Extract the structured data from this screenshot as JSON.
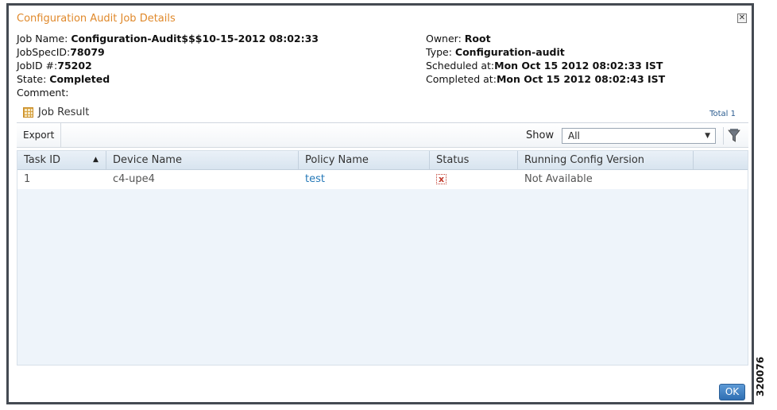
{
  "dialog": {
    "title": "Configuration Audit Job Details",
    "close_icon": "close-icon"
  },
  "details_left": [
    {
      "label": "Job Name: ",
      "value": "Configuration-Audit$$$10-15-2012 08:02:33"
    },
    {
      "label": "JobSpecID:",
      "value": "78079"
    },
    {
      "label": "JobID #:",
      "value": "75202"
    },
    {
      "label": "State: ",
      "value": "Completed"
    },
    {
      "label": "Comment:",
      "value": ""
    }
  ],
  "details_right": [
    {
      "label": "Owner: ",
      "value": "Root"
    },
    {
      "label": "Type: ",
      "value": "Configuration-audit"
    },
    {
      "label": "Scheduled at:",
      "value": "Mon Oct 15 2012 08:02:33 IST"
    },
    {
      "label": "Completed at:",
      "value": "Mon Oct 15 2012 08:02:43 IST"
    }
  ],
  "job_result": {
    "label": "Job Result",
    "icon": "table-grid-icon",
    "total": "Total 1"
  },
  "toolbar": {
    "export_label": "Export",
    "show_label": "Show",
    "show_selected": "All",
    "filter_icon": "filter-icon"
  },
  "table": {
    "columns": [
      "Task ID",
      "Device Name",
      "Policy Name",
      "Status",
      "Running Config Version"
    ],
    "sorted_column": "Task ID",
    "sort_direction": "ascending",
    "rows": [
      {
        "task_id": "1",
        "device_name": "c4-upe4",
        "policy_name": "test",
        "status": "failed",
        "status_icon": "error-x-icon",
        "running_config_version": "Not Available"
      }
    ]
  },
  "footer": {
    "ok_label": "OK"
  },
  "figure_number": "320076",
  "colors": {
    "title": "#e0892b",
    "link": "#2679b8",
    "ok_button": "#3c7fc1",
    "error": "#c0392b"
  }
}
